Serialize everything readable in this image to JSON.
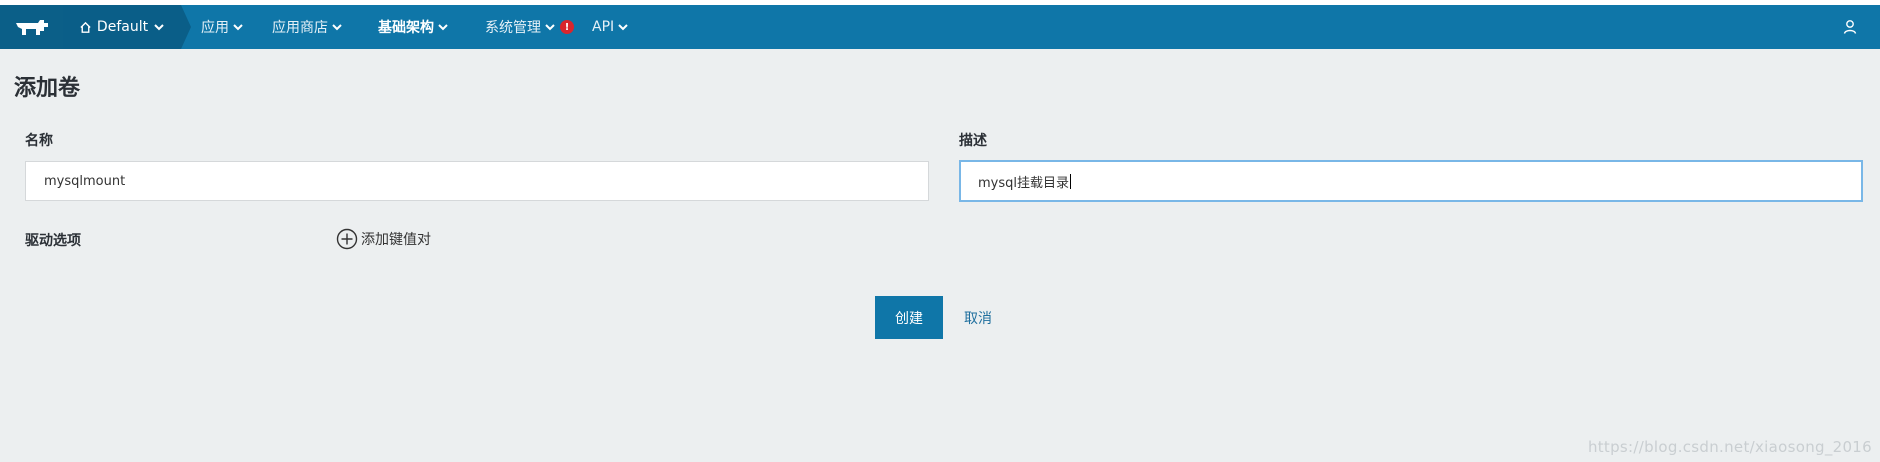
{
  "navbar": {
    "environment": "Default",
    "items": [
      {
        "label": "应用"
      },
      {
        "label": "应用商店"
      },
      {
        "label": "基础架构"
      },
      {
        "label": "系统管理",
        "badge": "!"
      },
      {
        "label": "API"
      }
    ],
    "icons": [
      "logo-icon",
      "home-icon",
      "chevron-down-icon",
      "user-icon"
    ],
    "colors": {
      "bar": "#0f76a8",
      "env": "#0a5e88",
      "badge": "#d9262d"
    }
  },
  "page": {
    "title": "添加卷",
    "name_label": "名称",
    "name_value": "mysqlmount",
    "desc_label": "描述",
    "desc_value": "mysql挂载目录",
    "driver_label": "驱动选项",
    "add_pair_label": "添加键值对",
    "create_label": "创建",
    "cancel_label": "取消"
  },
  "watermark": "https://blog.csdn.net/xiaosong_2016"
}
